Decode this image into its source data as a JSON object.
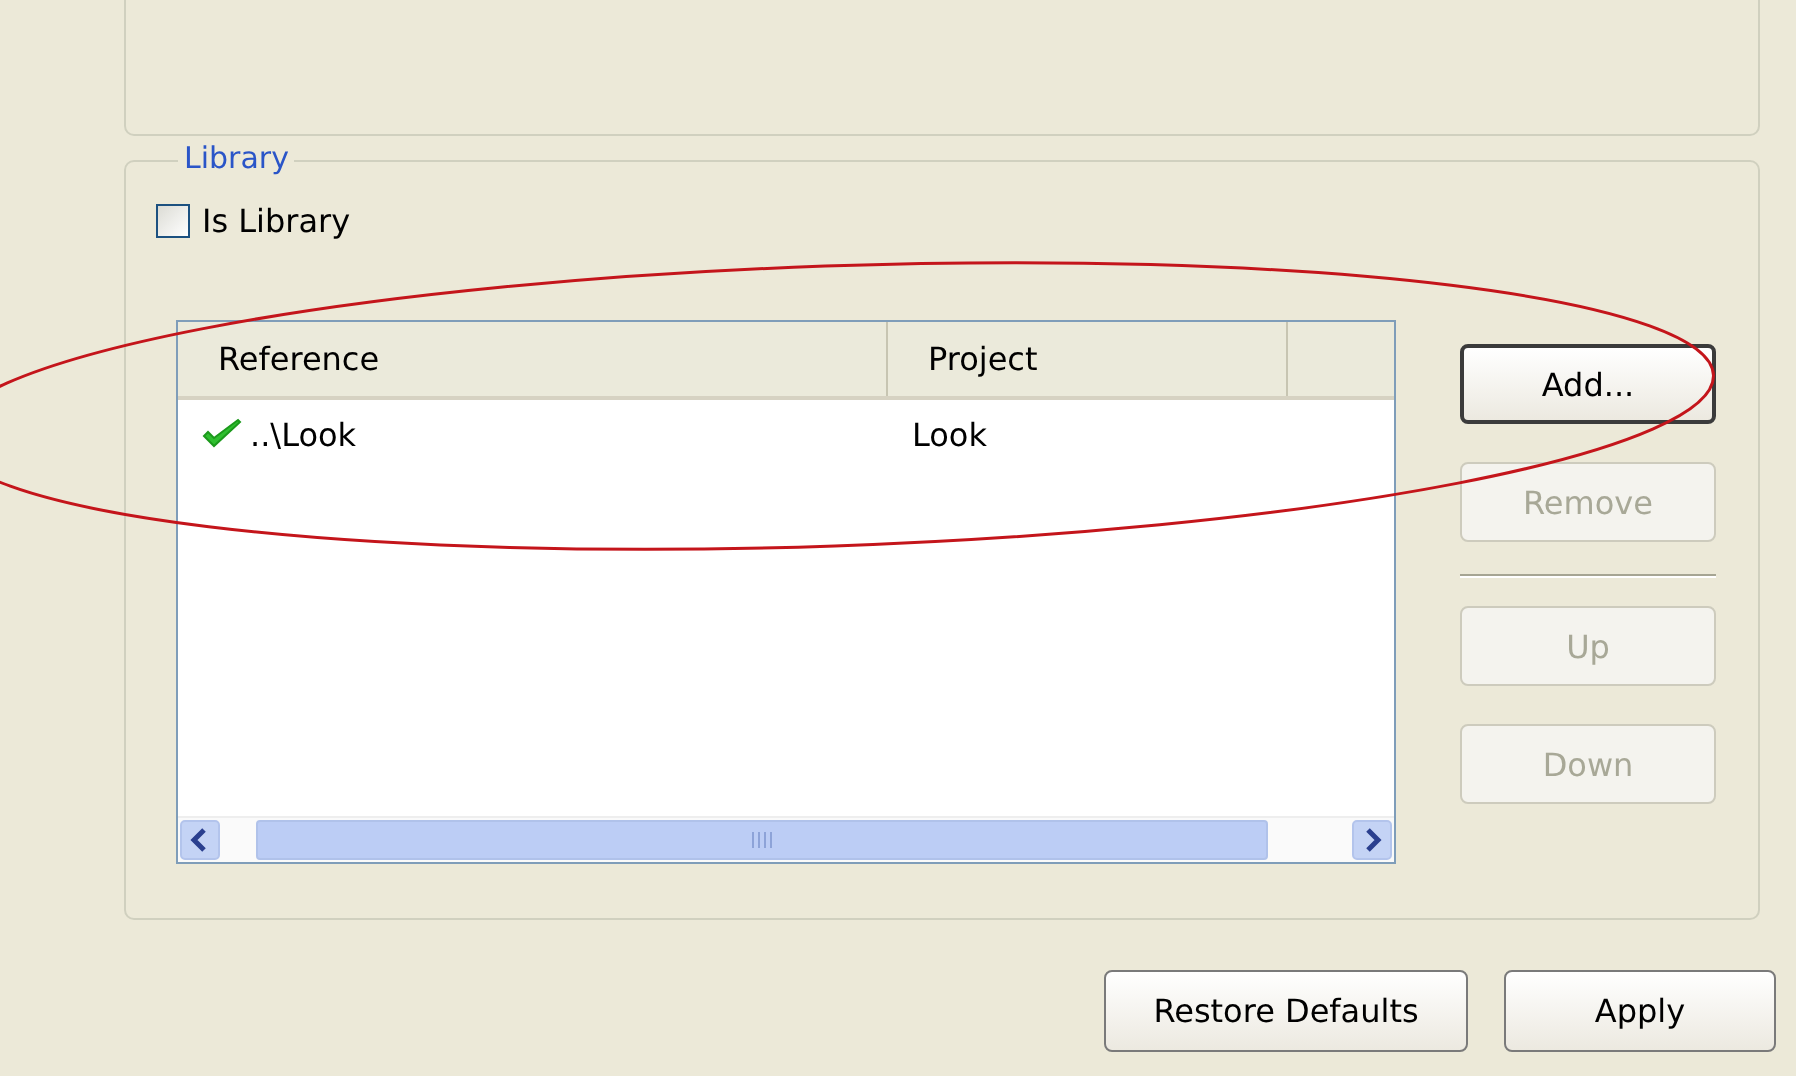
{
  "library_group": {
    "title": "Library",
    "is_library": {
      "label": "Is Library",
      "checked": false
    },
    "table": {
      "columns": [
        "Reference",
        "Project"
      ],
      "rows": [
        {
          "reference": "..\\Look",
          "project": "Look",
          "kind": "ok"
        }
      ]
    },
    "buttons": [
      {
        "label": "Add...",
        "disabled": false,
        "focused": true
      },
      {
        "label": "Remove",
        "disabled": true,
        "focused": false
      },
      {
        "label": "Up",
        "disabled": true,
        "focused": false
      },
      {
        "label": "Down",
        "disabled": true,
        "focused": false
      }
    ]
  },
  "footer_buttons": [
    {
      "label": "Restore Defaults"
    },
    {
      "label": "Apply"
    }
  ]
}
